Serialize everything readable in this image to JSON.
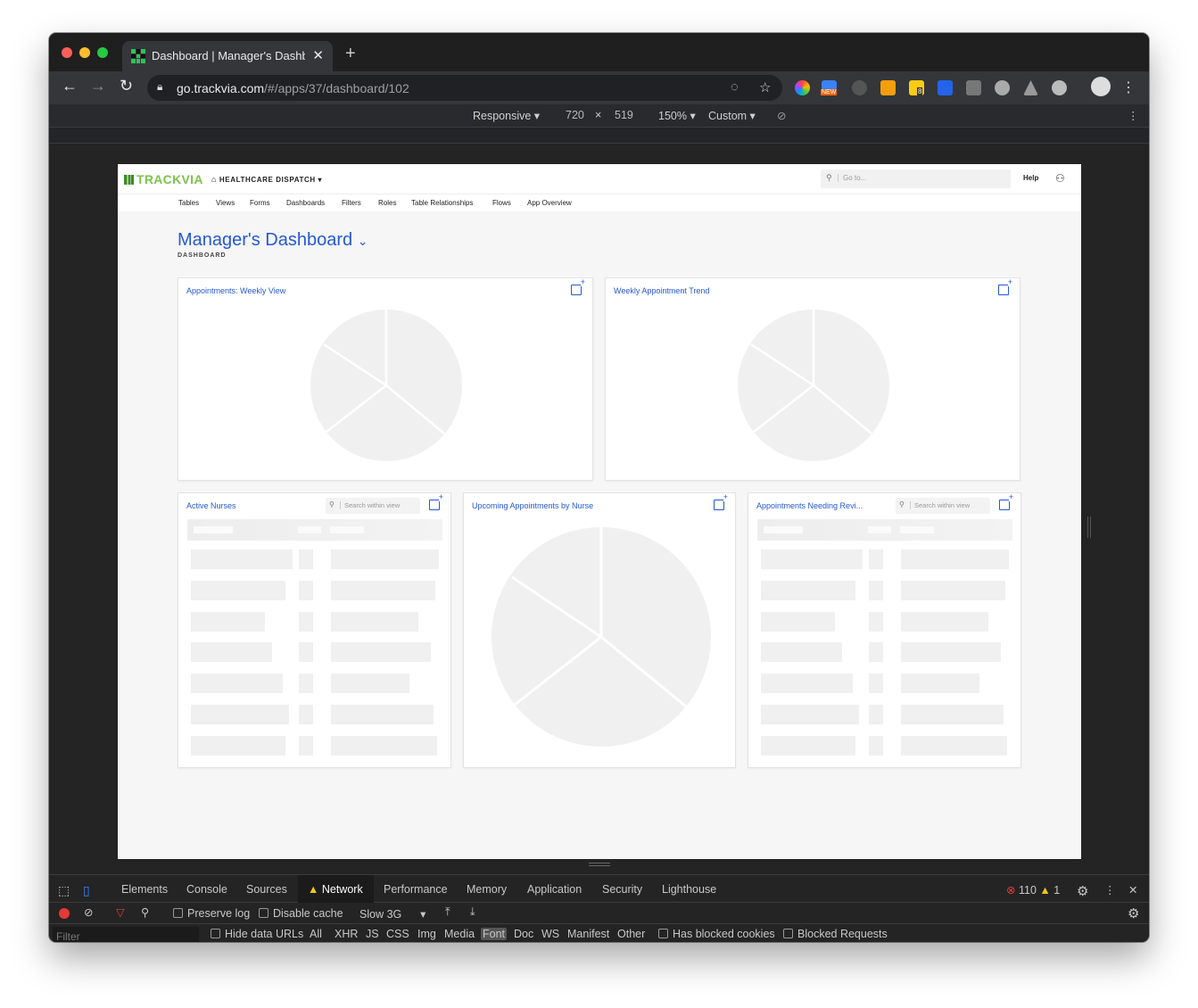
{
  "browser": {
    "tab_title": "Dashboard | Manager's Dashboard",
    "url_host": "go.trackvia.com",
    "url_path": "/#/apps/37/dashboard/102",
    "extension_badge_new": "NEW",
    "extension_badge_count": "8"
  },
  "device_toolbar": {
    "device": "Responsive ▾",
    "width": "720",
    "times": "×",
    "height": "519",
    "zoom": "150% ▾",
    "throttle": "Custom ▾"
  },
  "app": {
    "logo": "TRACKVIA",
    "app_name": "HEALTHCARE DISPATCH",
    "goto_placeholder": "Go to...",
    "help": "Help",
    "nav": [
      "Tables",
      "Views",
      "Forms",
      "Dashboards",
      "Filters",
      "Roles",
      "Table Relationships",
      "Flows",
      "App Overview"
    ],
    "page_title": "Manager's Dashboard",
    "page_subtitle": "DASHBOARD",
    "search_placeholder": "Search within view",
    "widgets": {
      "w1": "Appointments: Weekly View",
      "w2": "Weekly Appointment Trend",
      "w3": "Active Nurses",
      "w4": "Upcoming Appointments by Nurse",
      "w5": "Appointments Needing Revi..."
    }
  },
  "devtools": {
    "tabs": [
      "Elements",
      "Console",
      "Sources",
      "Network",
      "Performance",
      "Memory",
      "Application",
      "Security",
      "Lighthouse"
    ],
    "errors": "110",
    "warnings": "1",
    "preserve_log": "Preserve log",
    "disable_cache": "Disable cache",
    "throttle": "Slow 3G",
    "filter_placeholder": "Filter",
    "hide_data_urls": "Hide data URLs",
    "types": [
      "All",
      "XHR",
      "JS",
      "CSS",
      "Img",
      "Media",
      "Font",
      "Doc",
      "WS",
      "Manifest",
      "Other"
    ],
    "has_blocked_cookies": "Has blocked cookies",
    "blocked_requests": "Blocked Requests"
  },
  "colors": {
    "accent_blue": "#2458d6",
    "trackvia_green": "#7bc44a",
    "devtools_bg": "#242424"
  }
}
